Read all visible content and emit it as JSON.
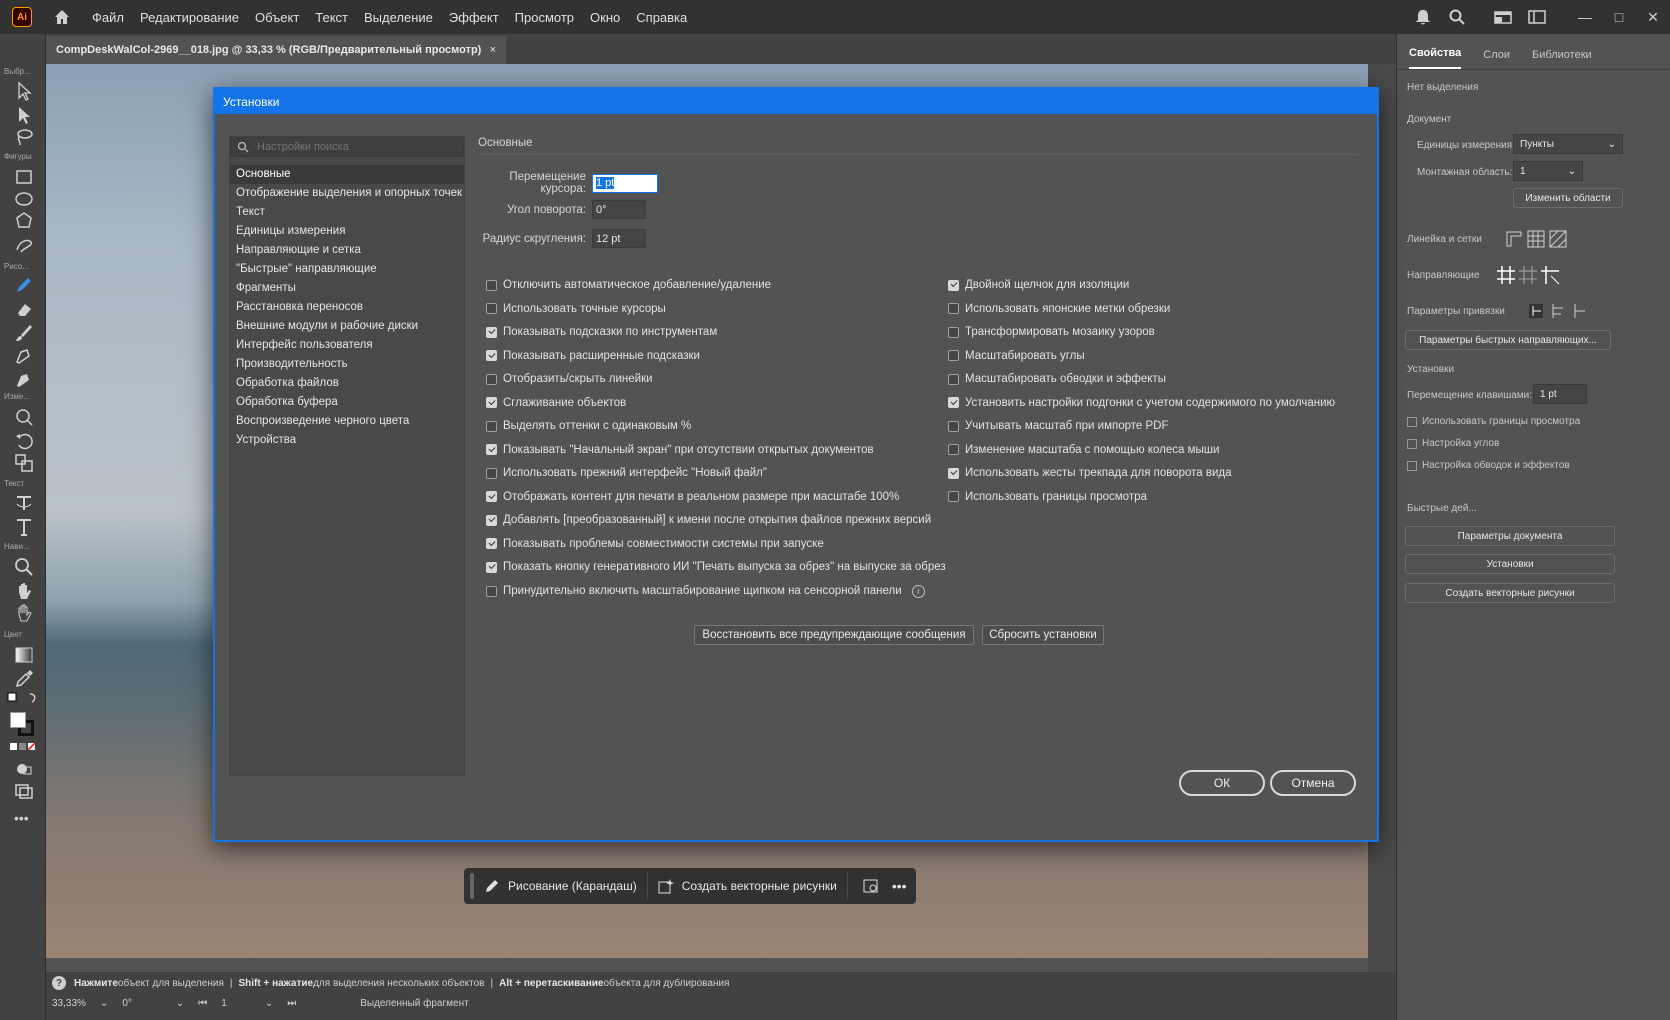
{
  "app": {
    "logo_text": "Ai",
    "menu": [
      "Файл",
      "Редактирование",
      "Объект",
      "Текст",
      "Выделение",
      "Эффект",
      "Просмотр",
      "Окно",
      "Справка"
    ],
    "window_controls": [
      "—",
      "□",
      "✕"
    ]
  },
  "document": {
    "tab_title": "CompDeskWalCol-2969__018.jpg @ 33,33 % (RGB/Предварительный просмотр)",
    "tab_close": "×"
  },
  "toolbar": {
    "groups": [
      "Выбр...",
      "Фигуры",
      "Рисо...",
      "Изме...",
      "Текст",
      "Нави...",
      "Цвет"
    ],
    "more": "•••"
  },
  "status": {
    "hint_1_bold": "Нажмите",
    "hint_1": " объект для выделения",
    "hint_2_bold": "Shift + нажатие",
    "hint_2": " для выделения нескольких объектов",
    "hint_3_bold": "Alt + перетаскивание",
    "hint_3": " объекта для дублирования",
    "sep": "|",
    "zoom": "33,33%",
    "rotation": "0°",
    "artboard": "1",
    "selection_mode": "Выделенный фрагмент"
  },
  "right_panel": {
    "tabs": [
      "Свойства",
      "Слои",
      "Библиотеки"
    ],
    "no_selection": "Нет выделения",
    "document_header": "Документ",
    "units_label": "Единицы измерения:",
    "units_value": "Пункты",
    "artboard_label": "Монтажная область:",
    "artboard_value": "1",
    "edit_artboards": "Изменить области",
    "rulers_grids": "Линейка и сетки",
    "guides": "Направляющие",
    "snap_options": "Параметры привязки",
    "smart_guides_btn": "Параметры быстрых направляющих...",
    "preferences_header": "Установки",
    "keyboard_increment_label": "Перемещение клавишами:",
    "keyboard_increment_value": "1 pt",
    "checks": [
      "Использовать границы просмотра",
      "Настройка углов",
      "Настройка обводок и эффектов"
    ],
    "quick_actions": "Быстрые дей...",
    "btn_doc_setup": "Параметры документа",
    "btn_preferences": "Установки",
    "btn_vectorize": "Создать векторные рисунки"
  },
  "dialog": {
    "title": "Установки",
    "search_placeholder": "Настройки поиска",
    "categories": [
      "Основные",
      "Отображение выделения и опорных точек",
      "Текст",
      "Единицы измерения",
      "Направляющие и сетка",
      "\"Быстрые\" направляющие",
      "Фрагменты",
      "Расстановка переносов",
      "Внешние модули и рабочие диски",
      "Интерфейс пользователя",
      "Производительность",
      "Обработка файлов",
      "Обработка буфера",
      "Воспроизведение черного цвета",
      "Устройства"
    ],
    "selected_category": "Основные",
    "section_title": "Основные",
    "fields": {
      "keyboard_increment_label": "Перемещение курсора:",
      "keyboard_increment_value": "1 pt",
      "constrain_angle_label": "Угол поворота:",
      "constrain_angle_value": "0°",
      "corner_radius_label": "Радиус скругления:",
      "corner_radius_value": "12 pt"
    },
    "left_checks": [
      {
        "label": "Отключить автоматическое добавление/удаление",
        "checked": false
      },
      {
        "label": "Использовать точные курсоры",
        "checked": false
      },
      {
        "label": "Показывать подсказки по инструментам",
        "checked": true
      },
      {
        "label": "Показывать расширенные подсказки",
        "checked": true
      },
      {
        "label": "Отобразить/скрыть линейки",
        "checked": false
      },
      {
        "label": "Сглаживание объектов",
        "checked": true
      },
      {
        "label": "Выделять оттенки с одинаковым %",
        "checked": false
      },
      {
        "label": "Показывать \"Начальный экран\" при отсутствии открытых документов",
        "checked": true
      },
      {
        "label": "Использовать прежний интерфейс \"Новый файл\"",
        "checked": false
      },
      {
        "label": "Отображать контент для печати в реальном размере при масштабе 100%",
        "checked": true
      },
      {
        "label": "Добавлять [преобразованный] к имени после открытия файлов прежних версий",
        "checked": true
      },
      {
        "label": "Показывать проблемы совместимости системы при запуске",
        "checked": true
      },
      {
        "label": "Показать кнопку генеративного ИИ \"Печать выпуска за обрез\" на выпуске за обрез",
        "checked": true
      },
      {
        "label": "Принудительно включить масштабирование щипком на сенсорной панели",
        "checked": false
      }
    ],
    "right_checks": [
      {
        "label": "Двойной щелчок для изоляции",
        "checked": true
      },
      {
        "label": "Использовать японские метки обрезки",
        "checked": false
      },
      {
        "label": "Трансформировать мозаику узоров",
        "checked": false
      },
      {
        "label": "Масштабировать углы",
        "checked": false
      },
      {
        "label": "Масштабировать обводки и эффекты",
        "checked": false
      },
      {
        "label": "Установить настройки подгонки с учетом содержимого по умолчанию",
        "checked": true
      },
      {
        "label": "Учитывать масштаб при импорте PDF",
        "checked": false
      },
      {
        "label": "Изменение масштаба с помощью колеса мыши",
        "checked": false
      },
      {
        "label": "Использовать жесты трекпада для поворота вида",
        "checked": true
      },
      {
        "label": "Использовать границы просмотра",
        "checked": false
      }
    ],
    "info_glyph": "i",
    "btn_reset_warnings": "Восстановить все предупреждающие сообщения",
    "btn_reset_prefs": "Сбросить установки",
    "btn_ok": "ОК",
    "btn_cancel": "Отмена"
  },
  "taskbar": {
    "draw_label": "Рисование (Карандаш)",
    "vectorize_label": "Создать векторные рисунки",
    "more": "•••"
  },
  "colors": {
    "accent": "#1473e6",
    "dialog_bg": "#535353",
    "menubar_bg": "#323232"
  }
}
